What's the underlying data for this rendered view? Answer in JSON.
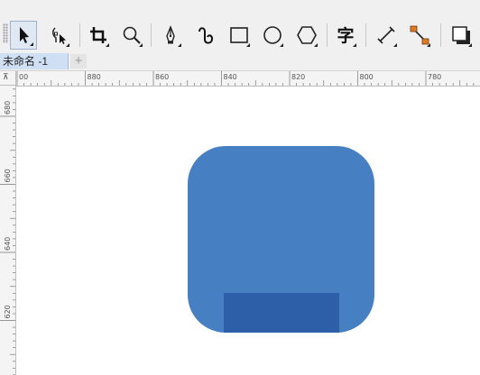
{
  "toolbar": {
    "tools": [
      {
        "icon": "pick-arrow-icon",
        "active": true
      },
      {
        "icon": "shape-node-icon"
      },
      {
        "icon": "crop-icon"
      },
      {
        "icon": "zoom-icon"
      },
      {
        "icon": "pen-icon"
      },
      {
        "icon": "artistic-media-icon"
      },
      {
        "icon": "rectangle-icon"
      },
      {
        "icon": "ellipse-icon"
      },
      {
        "icon": "polygon-icon"
      },
      {
        "icon": "text-icon",
        "glyph": "字"
      },
      {
        "icon": "dimension-line-icon"
      },
      {
        "icon": "connector-icon"
      },
      {
        "icon": "drop-shadow-icon"
      }
    ]
  },
  "document": {
    "tab_label": "未命名 -1",
    "add_tab_glyph": "+"
  },
  "rulers": {
    "horizontal_labels": [
      "00",
      "880",
      "860",
      "840",
      "820",
      "800",
      "780"
    ],
    "vertical_labels": [
      "680",
      "660",
      "640",
      "620"
    ],
    "corner_glyph": "⊼"
  },
  "canvas": {
    "shapes": [
      {
        "name": "rounded-square",
        "color": "#4680c2"
      },
      {
        "name": "bottom-rectangle",
        "color": "#2d5ea8"
      }
    ]
  }
}
